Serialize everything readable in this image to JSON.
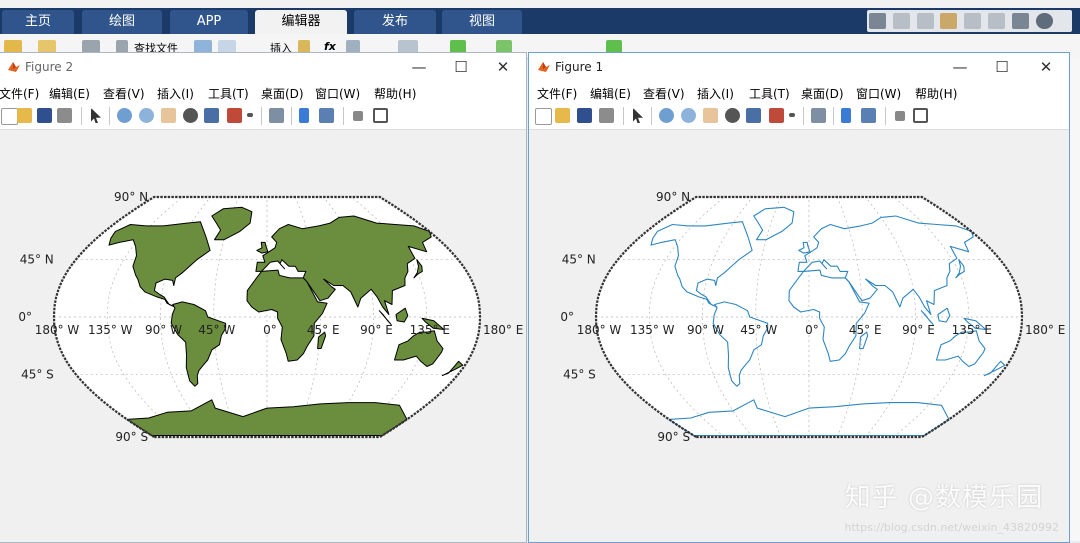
{
  "ribbon": {
    "tabs": [
      {
        "label": "主页",
        "active": false
      },
      {
        "label": "绘图",
        "active": false
      },
      {
        "label": "APP",
        "active": false
      },
      {
        "label": "编辑器",
        "active": true
      },
      {
        "label": "发布",
        "active": false
      },
      {
        "label": "视图",
        "active": false
      }
    ],
    "find_files": "查找文件",
    "insert": "插入",
    "fx": "fx"
  },
  "menu": [
    "文件(F)",
    "编辑(E)",
    "查看(V)",
    "插入(I)",
    "工具(T)",
    "桌面(D)",
    "窗口(W)",
    "帮助(H)"
  ],
  "figure2": {
    "title": "Figure 2",
    "land_color": "#6b8e3e",
    "coast_color": "#000000"
  },
  "figure1": {
    "title": "Figure 1",
    "coast_color": "#2e86c1"
  },
  "window_controls": {
    "minimize": "—",
    "maximize": "☐",
    "close": "✕"
  },
  "lat_labels": [
    "90° N",
    "45° N",
    "0°",
    "45° S",
    "90° S"
  ],
  "lon_labels": [
    "180° W",
    "135° W",
    "90° W",
    "45° W",
    "0°",
    "45° E",
    "90° E",
    "135° E",
    "180° E"
  ],
  "watermark": {
    "brand": "知乎 @数模乐园",
    "url": "https://blog.csdn.net/weixin_43820992"
  }
}
